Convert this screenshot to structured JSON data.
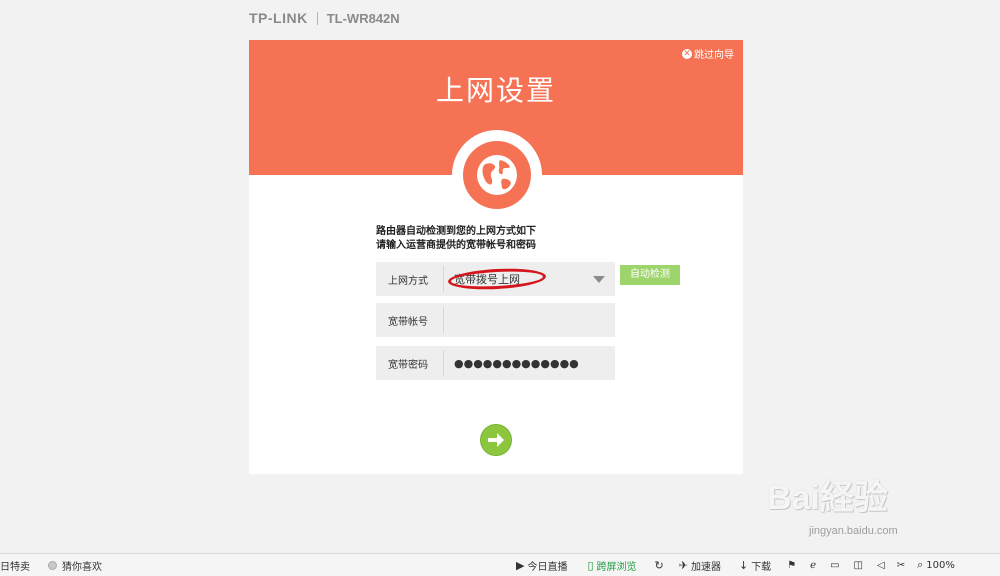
{
  "header": {
    "brand": "TP-LINK",
    "model": "TL-WR842N"
  },
  "hero": {
    "title": "上网设置",
    "skip_label": "跳过向导"
  },
  "instructions": {
    "line1": "路由器自动检测到您的上网方式如下",
    "line2": "请输入运营商提供的宽带帐号和密码"
  },
  "form": {
    "connection_type": {
      "label": "上网方式",
      "value": "宽带拨号上网"
    },
    "account": {
      "label": "宽带帐号",
      "value": ""
    },
    "password": {
      "label": "宽带密码",
      "value": "●●●●●●●●●●●●●"
    },
    "auto_detect_label": "自动检测"
  },
  "watermark": {
    "text": "Bai経验",
    "sub": "jingyan.baidu.com"
  },
  "statusbar": {
    "left": [
      "日特卖",
      "猜你喜欢"
    ],
    "right": [
      "今日直播",
      "跨屏浏览",
      "加速器",
      "下载",
      "100%"
    ]
  },
  "colors": {
    "accent": "#f57354",
    "button": "#9ed46c",
    "next": "#8cc63f",
    "highlight": "#d4151c"
  }
}
